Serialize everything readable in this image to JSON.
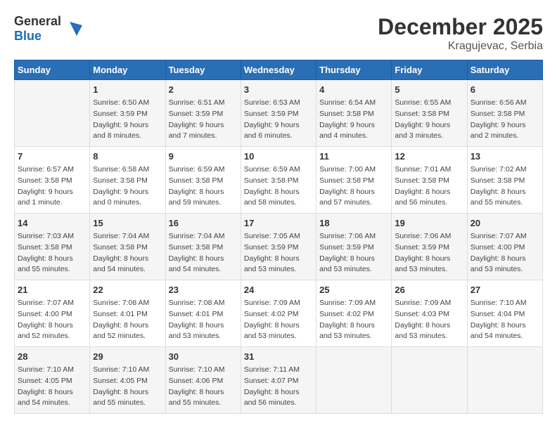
{
  "header": {
    "logo_general": "General",
    "logo_blue": "Blue",
    "month_title": "December 2025",
    "location": "Kragujevac, Serbia"
  },
  "days_of_week": [
    "Sunday",
    "Monday",
    "Tuesday",
    "Wednesday",
    "Thursday",
    "Friday",
    "Saturday"
  ],
  "weeks": [
    [
      {
        "day": "",
        "info": ""
      },
      {
        "day": "1",
        "info": "Sunrise: 6:50 AM\nSunset: 3:59 PM\nDaylight: 9 hours\nand 8 minutes."
      },
      {
        "day": "2",
        "info": "Sunrise: 6:51 AM\nSunset: 3:59 PM\nDaylight: 9 hours\nand 7 minutes."
      },
      {
        "day": "3",
        "info": "Sunrise: 6:53 AM\nSunset: 3:59 PM\nDaylight: 9 hours\nand 6 minutes."
      },
      {
        "day": "4",
        "info": "Sunrise: 6:54 AM\nSunset: 3:58 PM\nDaylight: 9 hours\nand 4 minutes."
      },
      {
        "day": "5",
        "info": "Sunrise: 6:55 AM\nSunset: 3:58 PM\nDaylight: 9 hours\nand 3 minutes."
      },
      {
        "day": "6",
        "info": "Sunrise: 6:56 AM\nSunset: 3:58 PM\nDaylight: 9 hours\nand 2 minutes."
      }
    ],
    [
      {
        "day": "7",
        "info": "Sunrise: 6:57 AM\nSunset: 3:58 PM\nDaylight: 9 hours\nand 1 minute."
      },
      {
        "day": "8",
        "info": "Sunrise: 6:58 AM\nSunset: 3:58 PM\nDaylight: 9 hours\nand 0 minutes."
      },
      {
        "day": "9",
        "info": "Sunrise: 6:59 AM\nSunset: 3:58 PM\nDaylight: 8 hours\nand 59 minutes."
      },
      {
        "day": "10",
        "info": "Sunrise: 6:59 AM\nSunset: 3:58 PM\nDaylight: 8 hours\nand 58 minutes."
      },
      {
        "day": "11",
        "info": "Sunrise: 7:00 AM\nSunset: 3:58 PM\nDaylight: 8 hours\nand 57 minutes."
      },
      {
        "day": "12",
        "info": "Sunrise: 7:01 AM\nSunset: 3:58 PM\nDaylight: 8 hours\nand 56 minutes."
      },
      {
        "day": "13",
        "info": "Sunrise: 7:02 AM\nSunset: 3:58 PM\nDaylight: 8 hours\nand 55 minutes."
      }
    ],
    [
      {
        "day": "14",
        "info": "Sunrise: 7:03 AM\nSunset: 3:58 PM\nDaylight: 8 hours\nand 55 minutes."
      },
      {
        "day": "15",
        "info": "Sunrise: 7:04 AM\nSunset: 3:58 PM\nDaylight: 8 hours\nand 54 minutes."
      },
      {
        "day": "16",
        "info": "Sunrise: 7:04 AM\nSunset: 3:58 PM\nDaylight: 8 hours\nand 54 minutes."
      },
      {
        "day": "17",
        "info": "Sunrise: 7:05 AM\nSunset: 3:59 PM\nDaylight: 8 hours\nand 53 minutes."
      },
      {
        "day": "18",
        "info": "Sunrise: 7:06 AM\nSunset: 3:59 PM\nDaylight: 8 hours\nand 53 minutes."
      },
      {
        "day": "19",
        "info": "Sunrise: 7:06 AM\nSunset: 3:59 PM\nDaylight: 8 hours\nand 53 minutes."
      },
      {
        "day": "20",
        "info": "Sunrise: 7:07 AM\nSunset: 4:00 PM\nDaylight: 8 hours\nand 53 minutes."
      }
    ],
    [
      {
        "day": "21",
        "info": "Sunrise: 7:07 AM\nSunset: 4:00 PM\nDaylight: 8 hours\nand 52 minutes."
      },
      {
        "day": "22",
        "info": "Sunrise: 7:08 AM\nSunset: 4:01 PM\nDaylight: 8 hours\nand 52 minutes."
      },
      {
        "day": "23",
        "info": "Sunrise: 7:08 AM\nSunset: 4:01 PM\nDaylight: 8 hours\nand 53 minutes."
      },
      {
        "day": "24",
        "info": "Sunrise: 7:09 AM\nSunset: 4:02 PM\nDaylight: 8 hours\nand 53 minutes."
      },
      {
        "day": "25",
        "info": "Sunrise: 7:09 AM\nSunset: 4:02 PM\nDaylight: 8 hours\nand 53 minutes."
      },
      {
        "day": "26",
        "info": "Sunrise: 7:09 AM\nSunset: 4:03 PM\nDaylight: 8 hours\nand 53 minutes."
      },
      {
        "day": "27",
        "info": "Sunrise: 7:10 AM\nSunset: 4:04 PM\nDaylight: 8 hours\nand 54 minutes."
      }
    ],
    [
      {
        "day": "28",
        "info": "Sunrise: 7:10 AM\nSunset: 4:05 PM\nDaylight: 8 hours\nand 54 minutes."
      },
      {
        "day": "29",
        "info": "Sunrise: 7:10 AM\nSunset: 4:05 PM\nDaylight: 8 hours\nand 55 minutes."
      },
      {
        "day": "30",
        "info": "Sunrise: 7:10 AM\nSunset: 4:06 PM\nDaylight: 8 hours\nand 55 minutes."
      },
      {
        "day": "31",
        "info": "Sunrise: 7:11 AM\nSunset: 4:07 PM\nDaylight: 8 hours\nand 56 minutes."
      },
      {
        "day": "",
        "info": ""
      },
      {
        "day": "",
        "info": ""
      },
      {
        "day": "",
        "info": ""
      }
    ]
  ]
}
